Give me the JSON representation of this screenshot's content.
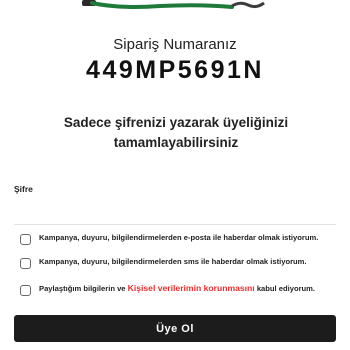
{
  "order": {
    "label": "Sipariş Numaranız",
    "number": "449MP5691N"
  },
  "intro_text": "Sadece şifrenizi yazarak üyeliğinizi tamamlayabilirsiniz",
  "password": {
    "label": "Şifre",
    "value": "",
    "placeholder": ""
  },
  "consents": [
    {
      "text": "Kampanya, duyuru, bilgilendirmelerden e-posta ile haberdar olmak istiyorum.",
      "checked": false
    },
    {
      "text": "Kampanya, duyuru, bilgilendirmelerden sms ile haberdar olmak istiyorum.",
      "checked": false
    },
    {
      "text_before": "Paylaştığım bilgilerin ve ",
      "link_text": "Kişisel verilerimin korunmasını",
      "text_after": " kabul ediyorum.",
      "checked": false
    }
  ],
  "submit_label": "Üye Ol",
  "colors": {
    "accent_link": "#e0312f",
    "button_bg": "#1c1c1c",
    "hero_green": "#1f7a3a"
  }
}
